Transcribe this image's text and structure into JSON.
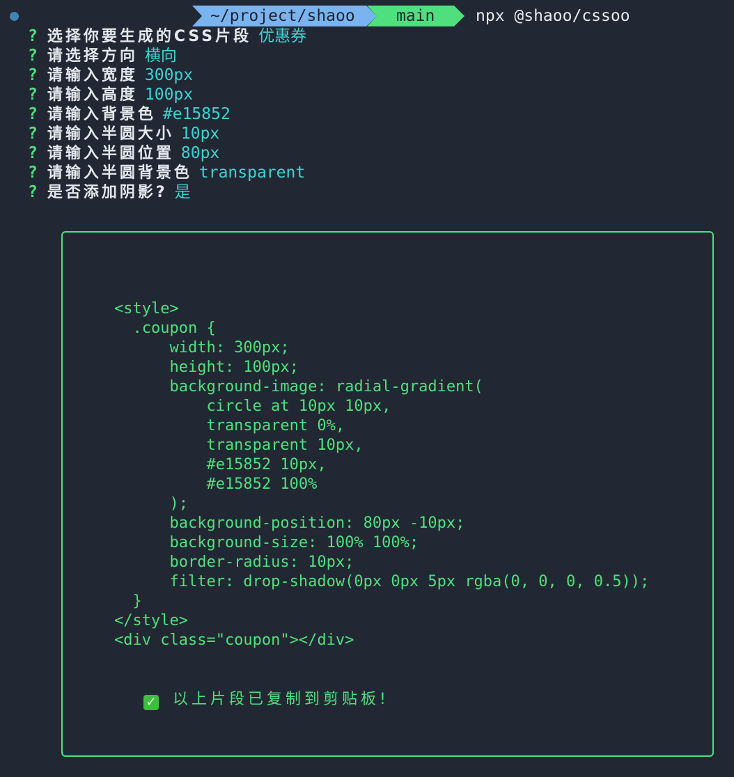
{
  "prompt": {
    "path": "~/project/shaoo",
    "branch_icon": "",
    "branch": "main",
    "command": "npx @shaoo/cssoo"
  },
  "questions": [
    {
      "mark": "?",
      "question": "选择你要生成的CSS片段",
      "answer": "优惠券"
    },
    {
      "mark": "?",
      "question": "请选择方向",
      "answer": "横向"
    },
    {
      "mark": "?",
      "question": "请输入宽度",
      "answer": "300px"
    },
    {
      "mark": "?",
      "question": "请输入高度",
      "answer": "100px"
    },
    {
      "mark": "?",
      "question": "请输入背景色",
      "answer": "#e15852"
    },
    {
      "mark": "?",
      "question": "请输入半圆大小",
      "answer": "10px"
    },
    {
      "mark": "?",
      "question": "请输入半圆位置",
      "answer": "80px"
    },
    {
      "mark": "?",
      "question": "请输入半圆背景色",
      "answer": "transparent"
    },
    {
      "mark": "?",
      "question": "是否添加阴影?",
      "answer": "是"
    }
  ],
  "code_lines": [
    "<style>",
    "  .coupon {",
    "      width: 300px;",
    "      height: 100px;",
    "      background-image: radial-gradient(",
    "          circle at 10px 10px,",
    "          transparent 0%,",
    "          transparent 10px,",
    "          #e15852 10px,",
    "          #e15852 100%",
    "      );",
    "      background-position: 80px -10px;",
    "      background-size: 100% 100%;",
    "      border-radius: 10px;",
    "      filter: drop-shadow(0px 0px 5px rgba(0, 0, 0, 0.5));",
    "  }",
    "</style>",
    "<div class=\"coupon\"></div>"
  ],
  "copied": {
    "icon": "check-mark-icon",
    "text": "以上片段已复制到剪贴板!"
  },
  "colors": {
    "background": "#222833",
    "accent_green": "#4fe07d",
    "answer_cyan": "#3dd3d3",
    "path_blue": "#79b4f0"
  }
}
